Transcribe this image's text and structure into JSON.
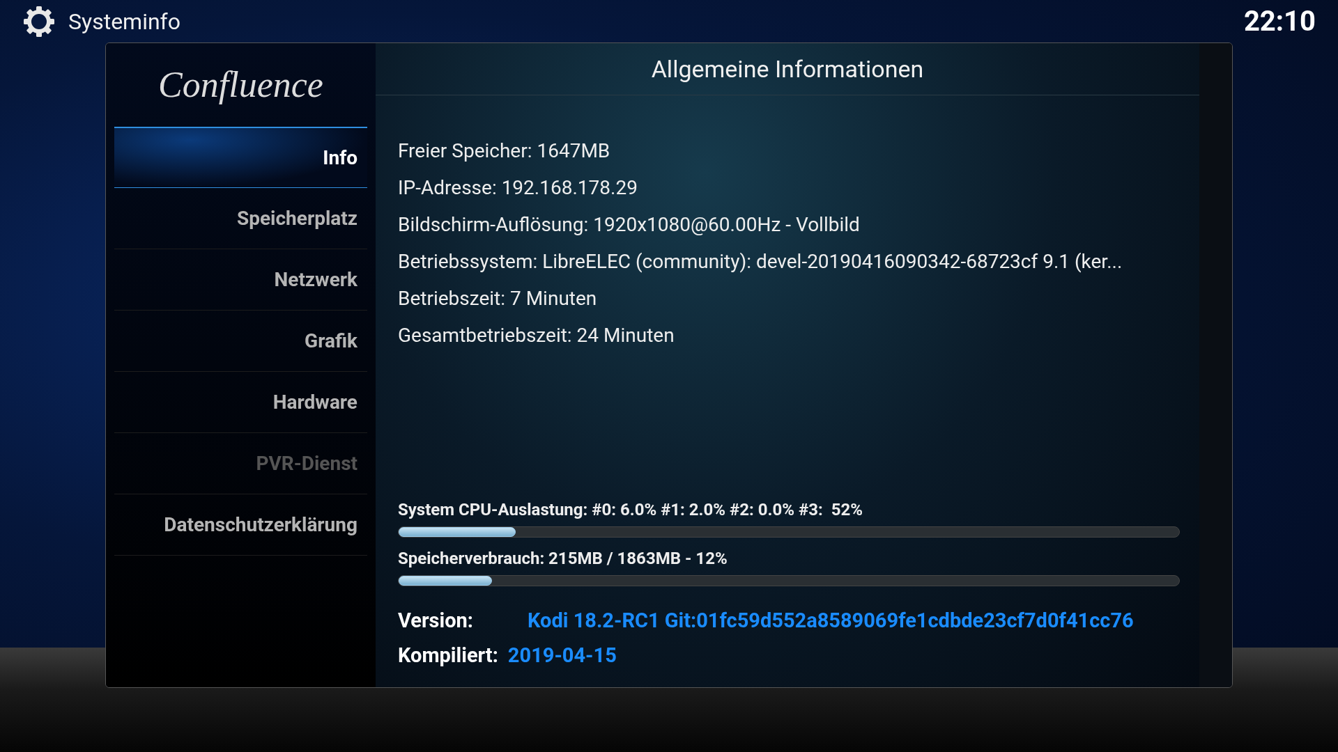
{
  "header": {
    "title": "Systeminfo",
    "clock": "22:10"
  },
  "logo": "Confluence",
  "sidebar": {
    "items": [
      {
        "label": "Info",
        "selected": true,
        "disabled": false
      },
      {
        "label": "Speicherplatz",
        "selected": false,
        "disabled": false
      },
      {
        "label": "Netzwerk",
        "selected": false,
        "disabled": false
      },
      {
        "label": "Grafik",
        "selected": false,
        "disabled": false
      },
      {
        "label": "Hardware",
        "selected": false,
        "disabled": false
      },
      {
        "label": "PVR-Dienst",
        "selected": false,
        "disabled": true
      },
      {
        "label": "Datenschutzerklärung",
        "selected": false,
        "disabled": false
      }
    ]
  },
  "content": {
    "heading": "Allgemeine Informationen",
    "info_lines": [
      "Freier Speicher: 1647MB",
      "IP-Adresse: 192.168.178.29",
      "Bildschirm-Auflösung: 1920x1080@60.00Hz - Vollbild",
      "Betriebssystem: LibreELEC (community): devel-20190416090342-68723cf 9.1 (ker...",
      "Betriebszeit: 7 Minuten",
      "Gesamtbetriebszeit: 24 Minuten"
    ],
    "meters": [
      {
        "label": "System CPU-Auslastung: #0: 6.0% #1: 2.0% #2: 0.0% #3:  52%",
        "level": 0.15
      },
      {
        "label": "Speicherverbrauch: 215MB / 1863MB - 12%",
        "level": 0.12
      }
    ],
    "version": {
      "label": "Version:",
      "value": "Kodi 18.2-RC1 Git:01fc59d552a8589069fe1cdbde23cf7d0f41cc76"
    },
    "compiled": {
      "label": "Kompiliert:",
      "value": "2019-04-15"
    }
  }
}
